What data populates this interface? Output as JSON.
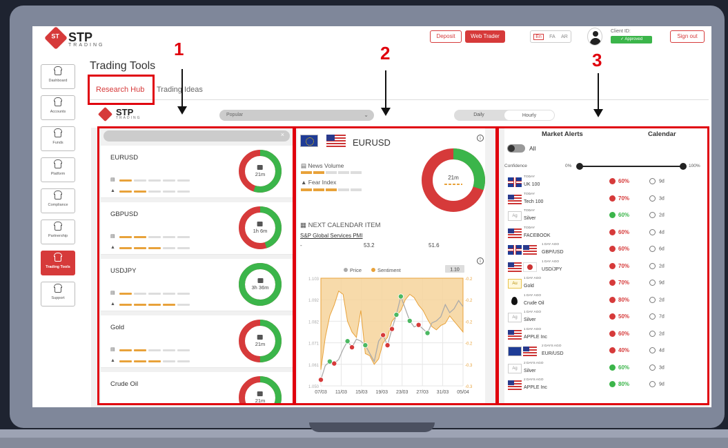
{
  "header": {
    "logo_main": "STP",
    "logo_sub": "TRADING",
    "deposit": "Deposit",
    "web_trader": "Web Trader",
    "langs": [
      "En",
      "FA",
      "AR"
    ],
    "client_id": "Client ID:",
    "approved": "Approved",
    "sign_out": "Sign out"
  },
  "sidebar": {
    "items": [
      {
        "label": "Dashboard",
        "icon": "home-icon"
      },
      {
        "label": "Accounts",
        "icon": "home-icon"
      },
      {
        "label": "Funds",
        "icon": "home-icon"
      },
      {
        "label": "Platform",
        "icon": "home-icon"
      },
      {
        "label": "Compliance",
        "icon": "home-icon"
      },
      {
        "label": "Partnership",
        "icon": "home-icon"
      },
      {
        "label": "Trading Tools",
        "icon": "home-icon",
        "active": true
      },
      {
        "label": "Support",
        "icon": "home-icon"
      }
    ]
  },
  "page": {
    "title": "Trading Tools",
    "tabs": [
      "Research Hub",
      "Trading Ideas"
    ]
  },
  "filters": {
    "logo_main": "STP",
    "logo_sub": "TRADING",
    "dropdown": "Popular",
    "toggle": [
      "Daily",
      "Hourly"
    ]
  },
  "annotations": [
    "1",
    "2",
    "3"
  ],
  "assets": [
    {
      "name": "EURUSD",
      "time": "21m",
      "news_bars": 1,
      "fear_bars": 2,
      "donut_green": 0.55
    },
    {
      "name": "GBPUSD",
      "time": "1h 6m",
      "news_bars": 2,
      "fear_bars": 3,
      "donut_green": 0.45
    },
    {
      "name": "USDJPY",
      "time": "3h 36m",
      "news_bars": 1,
      "fear_bars": 4,
      "donut_green": 1.0
    },
    {
      "name": "Gold",
      "time": "21m",
      "news_bars": 2,
      "fear_bars": 3,
      "donut_green": 0.5
    },
    {
      "name": "Crude Oil",
      "time": "21m",
      "news_bars": 1,
      "fear_bars": 2,
      "donut_green": 0.6
    }
  ],
  "detail": {
    "pair": "EURUSD",
    "news_volume": "News Volume",
    "fear_index": "Fear Index",
    "time": "21m",
    "next_calendar": "NEXT CALENDAR ITEM",
    "event": "S&P Global Services PMI",
    "dash": "-",
    "value1": "53.2",
    "value2": "51.6",
    "donut_green": 0.3,
    "news_bars": 2,
    "fear_bars": 3
  },
  "chart_data": {
    "type": "line",
    "legend": [
      "Price",
      "Sentiment"
    ],
    "badge": "1.10",
    "x_ticks": [
      "07/03",
      "11/03",
      "15/03",
      "19/03",
      "23/03",
      "27/03",
      "31/03",
      "05/04"
    ],
    "y_left_ticks": [
      "1.103",
      "1.092",
      "1.082",
      "1.071",
      "1.061",
      "1.050"
    ],
    "y_right_ticks": [
      "-0.2",
      "-0.2",
      "-0.2",
      "-0.2",
      "-0.3",
      "-0.3"
    ],
    "ylim": [
      1.05,
      1.103
    ],
    "series": [
      {
        "name": "Price",
        "values": [
          1.053,
          1.06,
          1.062,
          1.061,
          1.063,
          1.068,
          1.072,
          1.069,
          1.073,
          1.072,
          1.07,
          1.066,
          1.062,
          1.072,
          1.075,
          1.07,
          1.078,
          1.085,
          1.094,
          1.088,
          1.082,
          1.079,
          1.08,
          1.078,
          1.076,
          1.081,
          1.082,
          1.084,
          1.09,
          1.086,
          1.088,
          1.092,
          1.089
        ]
      },
      {
        "name": "Sentiment",
        "values": [
          0.85,
          0.55,
          0.35,
          0.25,
          0.12,
          0.15,
          0.4,
          0.5,
          0.55,
          0.3,
          0.7,
          0.72,
          0.8,
          0.75,
          0.6,
          0.55,
          0.4,
          0.35,
          0.3,
          0.2,
          0.15,
          0.18,
          0.25,
          0.3,
          0.38,
          0.45,
          0.48,
          0.44,
          0.42,
          0.35,
          0.4,
          0.45,
          0.5
        ]
      }
    ],
    "markers": [
      {
        "i": 0,
        "c": "red"
      },
      {
        "i": 2,
        "c": "green"
      },
      {
        "i": 3,
        "c": "red"
      },
      {
        "i": 6,
        "c": "green"
      },
      {
        "i": 7,
        "c": "red"
      },
      {
        "i": 10,
        "c": "green"
      },
      {
        "i": 14,
        "c": "red"
      },
      {
        "i": 15,
        "c": "red"
      },
      {
        "i": 16,
        "c": "red"
      },
      {
        "i": 17,
        "c": "green"
      },
      {
        "i": 18,
        "c": "green"
      },
      {
        "i": 20,
        "c": "green"
      },
      {
        "i": 22,
        "c": "red"
      },
      {
        "i": 24,
        "c": "green"
      }
    ]
  },
  "alerts": {
    "tabs": [
      "Market Alerts",
      "Calendar"
    ],
    "all": "All",
    "confidence": "Confidence",
    "min": "0%",
    "max": "100%",
    "rows": [
      {
        "when": "TODAY",
        "sym": "UK 100",
        "flags": [
          "uk"
        ],
        "pct": "60%",
        "col": "#d63a3a",
        "time": "9d"
      },
      {
        "when": "TODAY",
        "sym": "Tech 100",
        "flags": [
          "us"
        ],
        "pct": "70%",
        "col": "#d63a3a",
        "time": "3d"
      },
      {
        "when": "TODAY",
        "sym": "Silver",
        "flags": [
          "ag"
        ],
        "pct": "60%",
        "col": "#3bb54a",
        "time": "2d"
      },
      {
        "when": "TODAY",
        "sym": "FACEBOOK",
        "flags": [
          "us"
        ],
        "pct": "60%",
        "col": "#d63a3a",
        "time": "4d"
      },
      {
        "when": "1 DAY AGO",
        "sym": "GBP/USD",
        "flags": [
          "uk",
          "us"
        ],
        "pct": "60%",
        "col": "#d63a3a",
        "time": "6d"
      },
      {
        "when": "1 DAY AGO",
        "sym": "USD/JPY",
        "flags": [
          "us",
          "jp"
        ],
        "pct": "70%",
        "col": "#d63a3a",
        "time": "2d"
      },
      {
        "when": "1 DAY AGO",
        "sym": "Gold",
        "flags": [
          "au"
        ],
        "pct": "70%",
        "col": "#d63a3a",
        "time": "9d"
      },
      {
        "when": "1 DAY AGO",
        "sym": "Crude Oil",
        "flags": [
          "oil"
        ],
        "pct": "80%",
        "col": "#d63a3a",
        "time": "2d"
      },
      {
        "when": "1 DAY AGO",
        "sym": "Silver",
        "flags": [
          "ag"
        ],
        "pct": "50%",
        "col": "#d63a3a",
        "time": "7d"
      },
      {
        "when": "1 DAY AGO",
        "sym": "APPLE Inc",
        "flags": [
          "us"
        ],
        "pct": "60%",
        "col": "#d63a3a",
        "time": "2d"
      },
      {
        "when": "2 DAYS AGO",
        "sym": "EUR/USD",
        "flags": [
          "eu",
          "us"
        ],
        "pct": "40%",
        "col": "#d63a3a",
        "time": "4d"
      },
      {
        "when": "2 DAYS AGO",
        "sym": "Silver",
        "flags": [
          "ag"
        ],
        "pct": "60%",
        "col": "#3bb54a",
        "time": "3d"
      },
      {
        "when": "2 DAYS AGO",
        "sym": "APPLE Inc",
        "flags": [
          "us"
        ],
        "pct": "80%",
        "col": "#3bb54a",
        "time": "9d"
      }
    ]
  },
  "colors": {
    "brand": "#d63a3a",
    "green": "#3bb54a",
    "red": "#d63a3a",
    "orange": "#e8a23a",
    "annotation": "#e0000d"
  }
}
